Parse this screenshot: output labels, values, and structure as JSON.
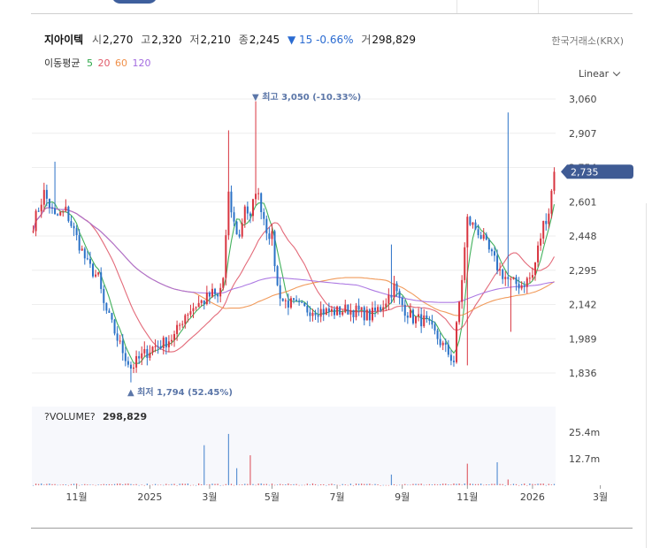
{
  "quote": {
    "name": "지아이텍",
    "open_label": "시",
    "open": "2,270",
    "high_label": "고",
    "high": "2,320",
    "low_label": "저",
    "low": "2,210",
    "close_label": "종",
    "close": "2,245",
    "change": "▼ 15 -0.66%",
    "volume_label": "거",
    "volume": "298,829"
  },
  "exchange": "한국거래소(KRX)",
  "moving_average": {
    "title": "이동평균",
    "periods": [
      {
        "label": "5",
        "color": "#2ea84a"
      },
      {
        "label": "20",
        "color": "#e05a6a"
      },
      {
        "label": "60",
        "color": "#f0904a"
      },
      {
        "label": "120",
        "color": "#a46ce0"
      }
    ]
  },
  "scale_mode": "Linear",
  "chart_data": {
    "type": "candlestick",
    "price_axis": {
      "min": 1760,
      "max": 3090,
      "ticks": [
        "3,060",
        "2,907",
        "2,754",
        "2,601",
        "2,448",
        "2,295",
        "2,142",
        "1,989",
        "1,836"
      ],
      "tick_values": [
        3060,
        2907,
        2754,
        2601,
        2448,
        2295,
        2142,
        1989,
        1836
      ]
    },
    "x_ticks": [
      "11월",
      "2025",
      "3월",
      "5월",
      "7월",
      "9월",
      "11월",
      "2026",
      "3월"
    ],
    "last_price": {
      "label": "2,735",
      "value": 2735
    },
    "high_annotation": {
      "text": "▼ 최고 3,050 (-10.33%)",
      "value": 3050
    },
    "low_annotation": {
      "text": "▲ 최저 1,794 (52.45%)",
      "value": 1794
    },
    "volume": {
      "title": "?VOLUME?",
      "value": "298,829",
      "axis_ticks": [
        "25.4m",
        "12.7m"
      ]
    },
    "price_anchors": [
      [
        0,
        2500
      ],
      [
        4,
        2640
      ],
      [
        8,
        2530
      ],
      [
        12,
        2560
      ],
      [
        16,
        2440
      ],
      [
        20,
        2320
      ],
      [
        24,
        2260
      ],
      [
        26,
        2140
      ],
      [
        29,
        2050
      ],
      [
        32,
        1960
      ],
      [
        36,
        1860
      ],
      [
        40,
        1910
      ],
      [
        44,
        1950
      ],
      [
        48,
        1970
      ],
      [
        52,
        2000
      ],
      [
        56,
        2100
      ],
      [
        60,
        2140
      ],
      [
        63,
        2160
      ],
      [
        66,
        2190
      ],
      [
        68,
        2170
      ],
      [
        70,
        2260
      ],
      [
        72,
        2620
      ],
      [
        74,
        2500
      ],
      [
        76,
        2440
      ],
      [
        78,
        2590
      ],
      [
        80,
        2520
      ],
      [
        82,
        2660
      ],
      [
        84,
        2580
      ],
      [
        86,
        2480
      ],
      [
        88,
        2440
      ],
      [
        90,
        2220
      ],
      [
        92,
        2160
      ],
      [
        96,
        2140
      ],
      [
        100,
        2120
      ],
      [
        104,
        2120
      ],
      [
        108,
        2110
      ],
      [
        112,
        2110
      ],
      [
        116,
        2120
      ],
      [
        120,
        2110
      ],
      [
        124,
        2090
      ],
      [
        128,
        2130
      ],
      [
        131,
        2180
      ],
      [
        133,
        2220
      ],
      [
        135,
        2160
      ],
      [
        137,
        2120
      ],
      [
        140,
        2080
      ],
      [
        144,
        2070
      ],
      [
        148,
        2010
      ],
      [
        152,
        1940
      ],
      [
        155,
        1890
      ],
      [
        156,
        2040
      ],
      [
        158,
        2260
      ],
      [
        160,
        2520
      ],
      [
        164,
        2470
      ],
      [
        168,
        2380
      ],
      [
        172,
        2290
      ],
      [
        176,
        2240
      ],
      [
        180,
        2230
      ],
      [
        184,
        2270
      ],
      [
        186,
        2390
      ],
      [
        188,
        2500
      ],
      [
        190,
        2560
      ],
      [
        192,
        2735
      ]
    ],
    "volume_spikes": [
      [
        63,
        19.5
      ],
      [
        72,
        25.0
      ],
      [
        75,
        8.3
      ],
      [
        80,
        14.6
      ],
      [
        132,
        5.2
      ],
      [
        160,
        10.5
      ],
      [
        171,
        11.2
      ],
      [
        175,
        2.8
      ]
    ]
  }
}
